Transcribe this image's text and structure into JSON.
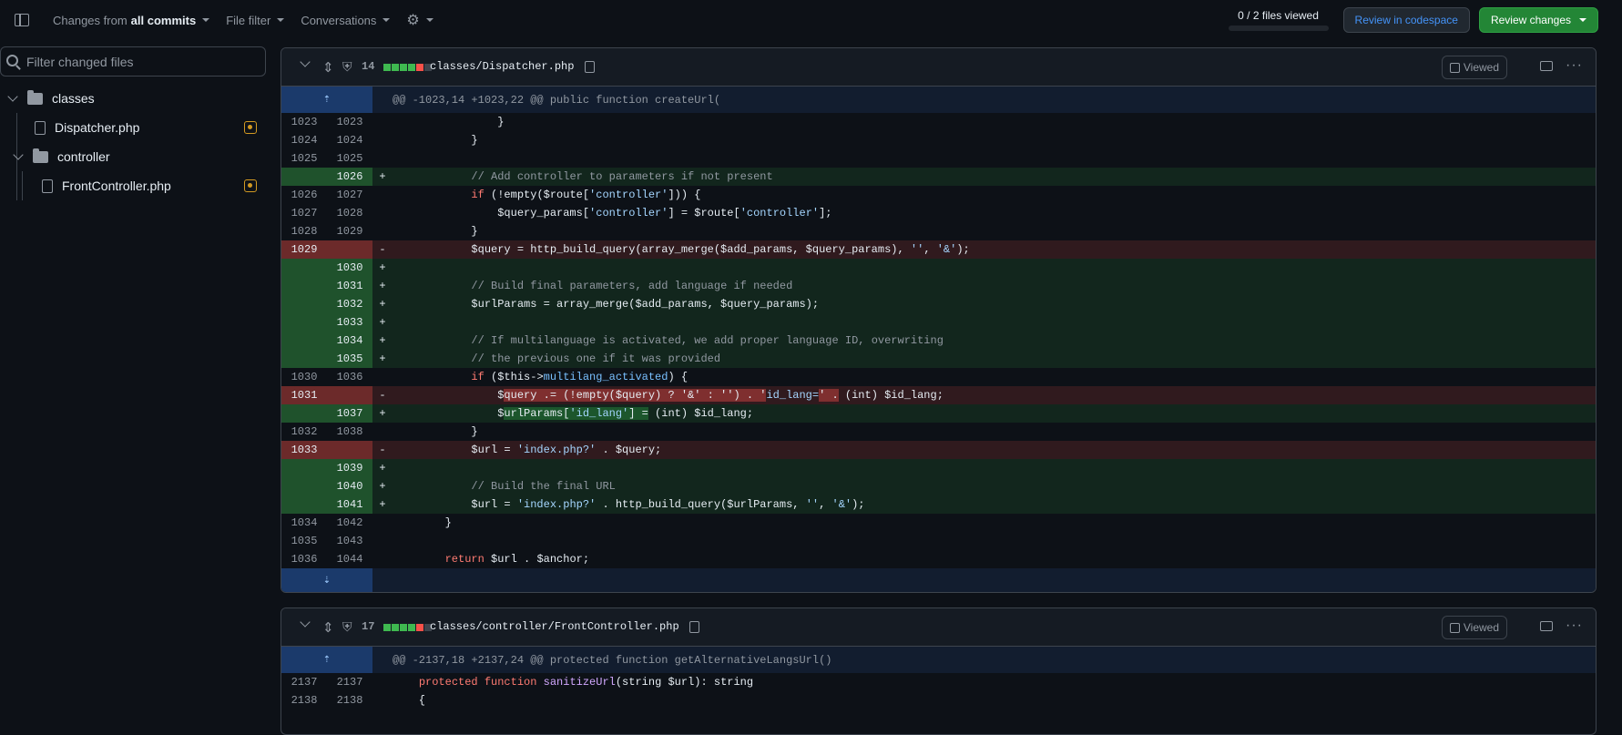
{
  "toolbar": {
    "changes_prefix": "Changes from ",
    "changes_value": "all commits",
    "file_filter": "File filter",
    "conversations": "Conversations",
    "files_viewed": "0 / 2 files viewed",
    "review_codespace": "Review in codespace",
    "review_changes": "Review changes"
  },
  "sidebar": {
    "filter_placeholder": "Filter changed files",
    "tree": {
      "folder_classes": "classes",
      "file_dispatcher": "Dispatcher.php",
      "folder_controller": "controller",
      "file_frontcontroller": "FrontController.php"
    }
  },
  "files": [
    {
      "count": "14",
      "name": "classes/Dispatcher.php",
      "viewed": "Viewed",
      "hunk": "@@ -1023,14 +1023,22 @@ public function createUrl(",
      "blocks": [
        "#3fb950",
        "#3fb950",
        "#3fb950",
        "#3fb950",
        "#f85149"
      ]
    },
    {
      "count": "17",
      "name": "classes/controller/FrontController.php",
      "viewed": "Viewed",
      "hunk": "@@ -2137,18 +2137,24 @@ protected function getAlternativeLangsUrl()",
      "blocks": [
        "#3fb950",
        "#3fb950",
        "#3fb950",
        "#3fb950",
        "#f85149"
      ]
    }
  ],
  "icons": {
    "expand_up": "⇡",
    "expand_down": "⇣",
    "gear": "⚙",
    "kebab": "···",
    "expand_all": "⇕",
    "shield": "⛨"
  },
  "colors": {
    "added": "#3fb950",
    "deleted": "#f85149",
    "accent": "#4493f8"
  }
}
